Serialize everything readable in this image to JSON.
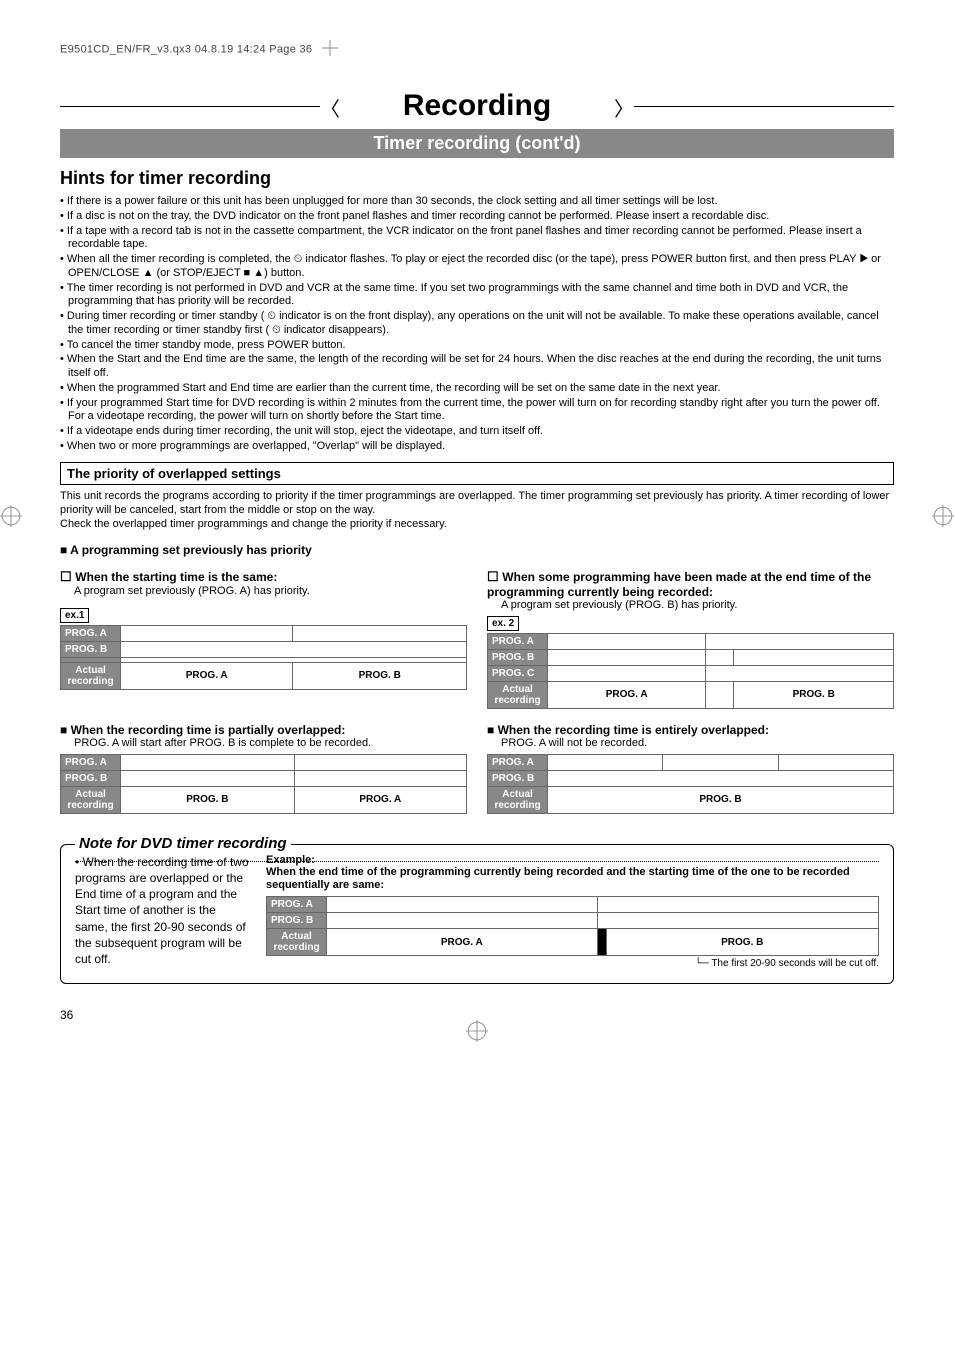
{
  "print_header": "E9501CD_EN/FR_v3.qx3  04.8.19  14:24  Page 36",
  "title": "Recording",
  "subtitle": "Timer recording (cont'd)",
  "hints_heading": "Hints for timer recording",
  "bullets": [
    "If there is a power failure or this unit has been unplugged for more than 30 seconds, the clock setting and all timer settings will be lost.",
    "If a disc is not on the tray, the DVD indicator on the front panel flashes and timer recording cannot be performed. Please insert a recordable disc.",
    "If a tape with a record tab is not in the cassette compartment, the VCR indicator on the front panel flashes and timer recording cannot be performed. Please insert a recordable tape.",
    "When all the timer recording is completed, the ⏲ indicator flashes. To play or eject the recorded disc (or the tape), press POWER button first, and then press PLAY ▶ or OPEN/CLOSE ▲ (or STOP/EJECT ■ ▲) button.",
    "The timer recording is not performed in DVD and VCR at the same time. If you set two programmings with the same channel and time both in DVD and VCR, the programming that has priority will be recorded.",
    "During timer recording or timer standby ( ⏲ indicator is on the front display), any operations on the unit will not be available. To make these operations available, cancel the timer recording or timer standby first ( ⏲ indicator disappears).",
    "To cancel the timer standby mode, press POWER button.",
    "When the Start and the End time are the same, the length of the recording will be set for 24 hours. When the disc reaches at the end during the recording, the unit turns itself off.",
    "When the programmed Start and End time are earlier than the current time, the recording will be set on the same date in the next year.",
    "If your programmed Start time for DVD recording is within 2 minutes from the current time, the power will turn on for recording standby right after you turn the power off. For a videotape recording, the power will turn on shortly before the Start time.",
    "If a videotape ends during timer recording, the unit will stop, eject the videotape, and turn itself off.",
    "When two or more programmings are overlapped, \"Overlap\" will be displayed."
  ],
  "priority_heading": "The priority of overlapped settings",
  "priority_text": "This unit records the programs according to priority if the timer programmings are overlapped. The timer programming set previously has priority. A timer recording of lower priority will be canceled, start from the middle or stop on the way.\nCheck the overlapped timer programmings and change the priority if necessary.",
  "sect1": "A programming set previously has priority",
  "case1_title": "When the starting time is the same:",
  "case1_desc": "A program set previously (PROG. A) has priority.",
  "ex1": "ex.1",
  "case2_title": "When some programming have been made at the end time of the programming currently being recorded:",
  "case2_desc": "A program set previously (PROG. B) has priority.",
  "ex2": "ex. 2",
  "case3_title": "When the recording time is partially overlapped:",
  "case3_desc": "PROG. A will start after PROG. B is complete to be recorded.",
  "case4_title": "When the recording time is entirely overlapped:",
  "case4_desc": "PROG. A will not be recorded.",
  "labels": {
    "progA": "PROG. A",
    "progB": "PROG. B",
    "progC": "PROG. C",
    "actual": "Actual recording"
  },
  "note_title": "Note for DVD timer recording",
  "note_left": "• When the recording time of two programs are overlapped or the End time of a program and the Start time of another is the same, the first 20-90 seconds of the subsequent program will be cut off.",
  "note_example_label": "Example:",
  "note_example_desc": "When the end time of the programming currently being recorded and the starting time of the one to be recorded sequentially are same:",
  "cutoff_note": "The first 20-90 seconds will be cut off.",
  "page_number": "36"
}
